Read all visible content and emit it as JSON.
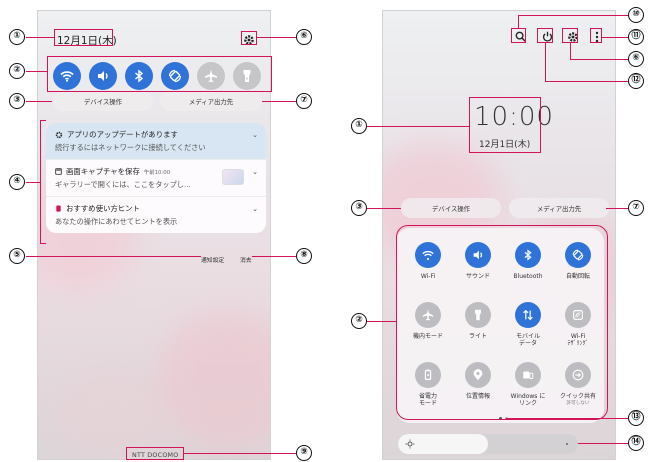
{
  "left_panel": {
    "date": "12月1日(木)",
    "quick_buttons": [
      {
        "icon": "wifi-icon",
        "on": true
      },
      {
        "icon": "sound-icon",
        "on": true
      },
      {
        "icon": "bluetooth-icon",
        "on": true
      },
      {
        "icon": "auto-rotate-icon",
        "on": true
      },
      {
        "icon": "airplane-icon",
        "on": false
      },
      {
        "icon": "flashlight-icon",
        "on": false
      }
    ],
    "device_control": "デバイス操作",
    "media_output": "メディア出力先",
    "notifications": [
      {
        "title": "アプリのアップデートがあります",
        "body": "続行するにはネットワークに接続してください",
        "icon": "gear-icon"
      },
      {
        "title": "画面キャプチャを保存",
        "time": "午前10:00",
        "body": "ギャラリーで開くには、ここをタップし...",
        "icon": "screenshot-icon"
      },
      {
        "title": "おすすめ使い方ヒント",
        "body": "あなたの操作にあわせてヒントを表示",
        "icon": "tip-icon"
      }
    ],
    "notification_settings": "通知設定",
    "clear": "消去",
    "carrier": "NTT DOCOMO"
  },
  "right_panel": {
    "clock": "10:00",
    "date": "12月1日(木)",
    "device_control": "デバイス操作",
    "media_output": "メディア出力先",
    "tiles": [
      {
        "label": "Wi-Fi",
        "icon": "wifi-icon",
        "on": true
      },
      {
        "label": "サウンド",
        "icon": "sound-icon",
        "on": true
      },
      {
        "label": "Bluetooth",
        "icon": "bluetooth-icon",
        "on": true
      },
      {
        "label": "自動回転",
        "icon": "auto-rotate-icon",
        "on": true
      },
      {
        "label": "機内モード",
        "icon": "airplane-icon",
        "on": false
      },
      {
        "label": "ライト",
        "icon": "flashlight-icon",
        "on": false
      },
      {
        "label": "モバイル",
        "label2": "データ",
        "icon": "mobile-data-icon",
        "on": true
      },
      {
        "label": "Wi-Fi",
        "label2": "ﾃｻﾞﾘﾝｸﾞ",
        "icon": "wifi-tethering-icon",
        "on": false
      },
      {
        "label": "省電力",
        "label2": "モード",
        "icon": "power-saving-icon",
        "on": false
      },
      {
        "label": "位置情報",
        "icon": "location-icon",
        "on": false
      },
      {
        "label": "Windows に",
        "label2": "リンク",
        "icon": "windows-link-icon",
        "on": false
      },
      {
        "label": "クイック共有",
        "sub": "許可しない",
        "icon": "quick-share-icon",
        "on": false
      }
    ],
    "brightness_level": 0.5,
    "page_count": 2,
    "current_page": 1
  },
  "callouts": [
    "①",
    "②",
    "③",
    "④",
    "⑤",
    "⑥",
    "⑦",
    "⑧",
    "⑨",
    "⑩",
    "⑪",
    "⑫",
    "⑬",
    "⑭"
  ],
  "colors": {
    "accent": "#2f73d8",
    "callout_line": "#d4145a",
    "tile_off": "#bdbdc1"
  }
}
